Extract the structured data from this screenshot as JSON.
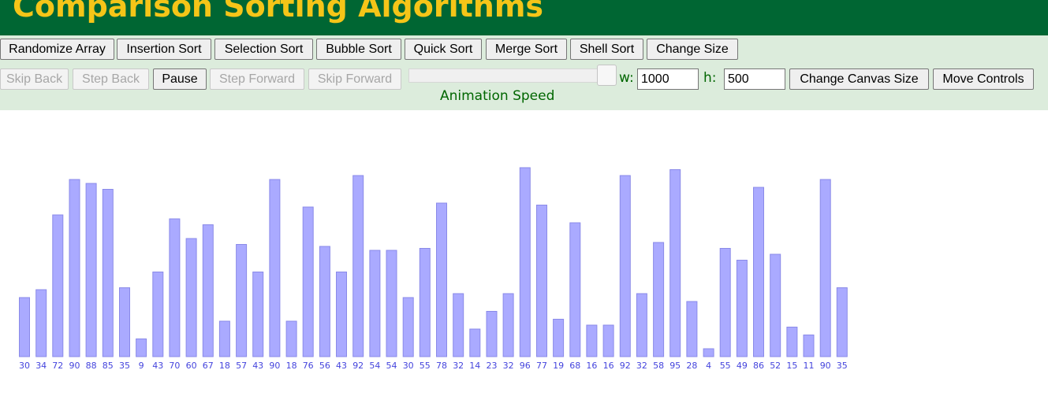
{
  "app": {
    "title": "Comparison Sorting Algorithms"
  },
  "toolbar": {
    "row1": [
      "Randomize Array",
      "Insertion Sort",
      "Selection Sort",
      "Bubble Sort",
      "Quick Sort",
      "Merge Sort",
      "Shell Sort",
      "Change Size"
    ],
    "row2": [
      {
        "label": "Skip Back",
        "enabled": false
      },
      {
        "label": "Step Back",
        "enabled": false
      },
      {
        "label": "Pause",
        "enabled": true
      },
      {
        "label": "Step Forward",
        "enabled": false
      },
      {
        "label": "Skip Forward",
        "enabled": false
      }
    ],
    "speed_label": "Animation Speed",
    "speed_value": 1.0,
    "width_label": "w:",
    "width_value": "1000",
    "height_label": "h:",
    "height_value": "500",
    "change_canvas_label": "Change Canvas Size",
    "move_controls_label": "Move Controls"
  },
  "colors": {
    "header_bg": "#006633",
    "title": "#f5c518",
    "controls_bg": "#dcecdc",
    "bar_fill": "#aaaaff",
    "bar_label": "#4444dd"
  },
  "chart_data": {
    "type": "bar",
    "values": [
      30,
      34,
      72,
      90,
      88,
      85,
      35,
      9,
      43,
      70,
      60,
      67,
      18,
      57,
      43,
      90,
      18,
      76,
      56,
      43,
      92,
      54,
      54,
      30,
      55,
      78,
      32,
      14,
      23,
      32,
      96,
      77,
      19,
      68,
      16,
      16,
      92,
      32,
      58,
      95,
      28,
      4,
      55,
      49,
      86,
      52,
      15,
      11,
      90,
      35
    ],
    "ylim": [
      0,
      100
    ]
  }
}
